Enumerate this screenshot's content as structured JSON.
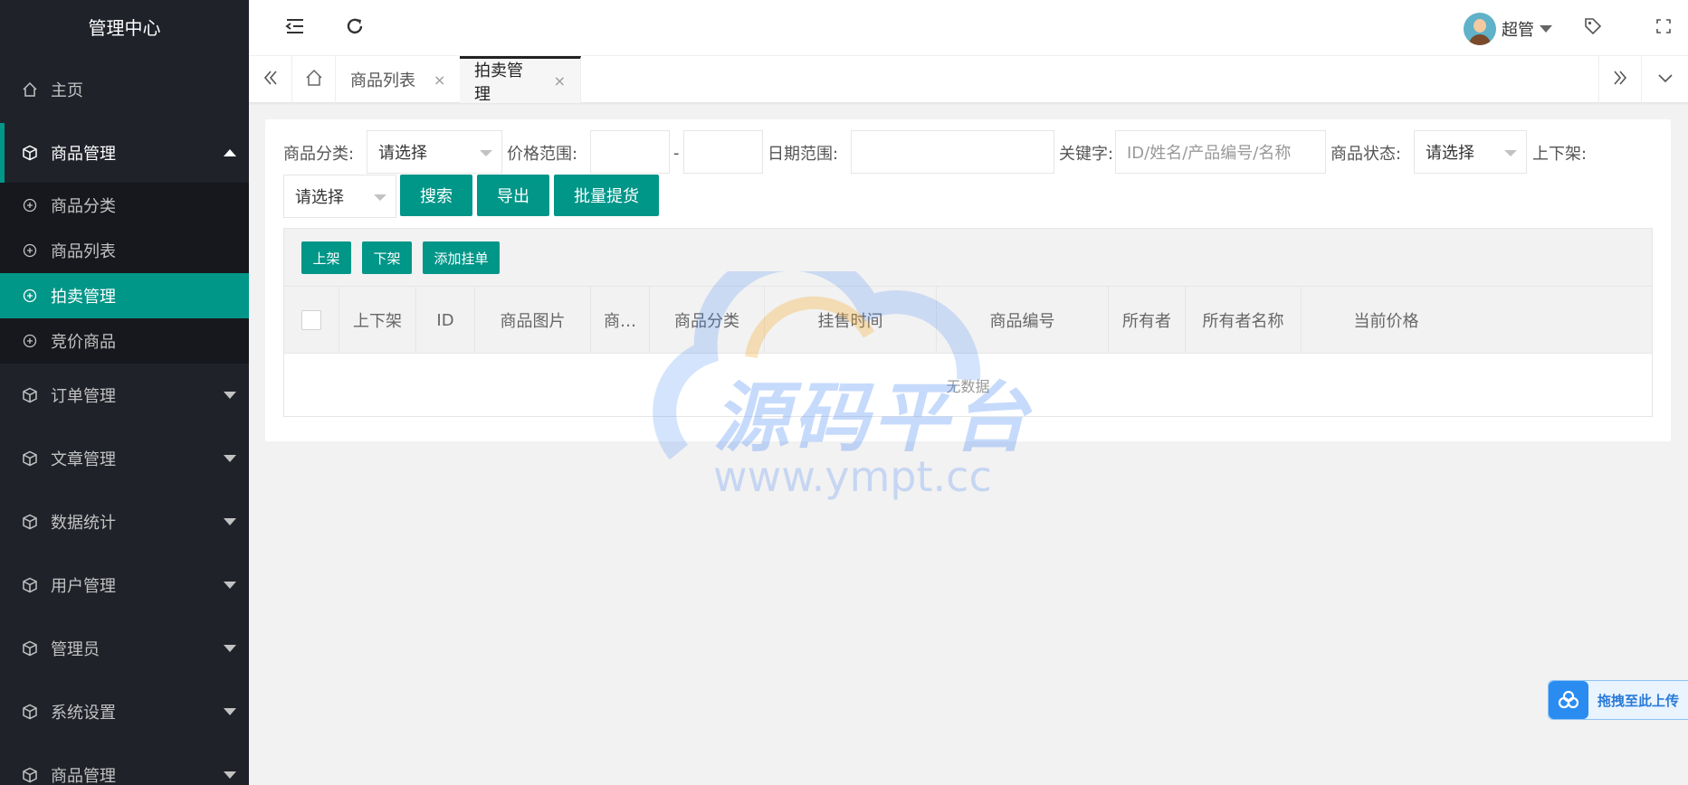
{
  "sidebar": {
    "brand": "管理中心",
    "home": "主页",
    "goods_menu": "商品管理",
    "sub_items": [
      "商品分类",
      "商品列表",
      "拍卖管理",
      "竞价商品"
    ],
    "menus": [
      "订单管理",
      "文章管理",
      "数据统计",
      "用户管理",
      "管理员",
      "系统设置",
      "商品管理"
    ]
  },
  "header": {
    "user_name": "超管"
  },
  "tabs": {
    "items": [
      "商品列表",
      "拍卖管理"
    ],
    "close": "×"
  },
  "filters": {
    "category_label": "商品分类:",
    "category_value": "请选择",
    "price_label": "价格范围:",
    "price_sep": "-",
    "date_label": "日期范围:",
    "keyword_label": "关键字:",
    "keyword_placeholder": "ID/姓名/产品编号/名称",
    "status_label": "商品状态:",
    "status_value": "请选择",
    "shelf_label": "上下架:",
    "shelf_value": "请选择",
    "search_btn": "搜索",
    "export_btn": "导出",
    "batch_btn": "批量提货"
  },
  "table": {
    "toolbar": [
      "上架",
      "下架",
      "添加挂单"
    ],
    "columns": [
      "上下架",
      "ID",
      "商品图片",
      "商…",
      "商品分类",
      "挂售时间",
      "商品编号",
      "所有者",
      "所有者名称",
      "当前价格"
    ],
    "empty": "无数据"
  },
  "watermark": {
    "title": "源码平台",
    "url": "www.ympt.cc"
  },
  "upload": {
    "label": "拖拽至此上传"
  },
  "colors": {
    "accent": "#009688",
    "sidebar_bg": "#20222a"
  }
}
